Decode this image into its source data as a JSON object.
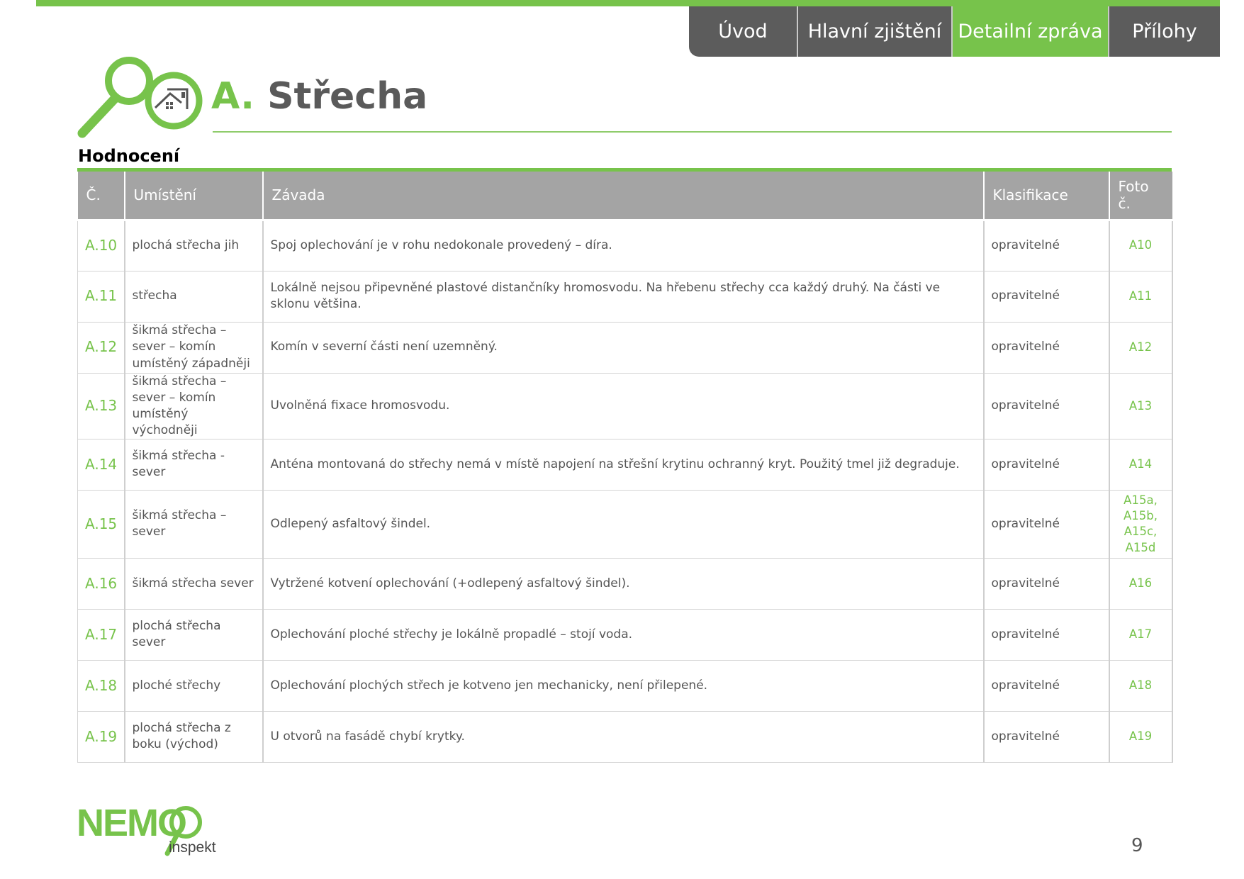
{
  "nav": {
    "tabs": [
      {
        "label": "Úvod",
        "active": false
      },
      {
        "label": "Hlavní zjištění",
        "active": false
      },
      {
        "label": "Detailní zpráva",
        "active": true
      },
      {
        "label": "Přílohy",
        "active": false
      }
    ]
  },
  "header": {
    "section_letter": "A.",
    "section_name": "Střecha",
    "icons": [
      "magnifier-icon",
      "house-roof-icon"
    ]
  },
  "subheading": "Hodnocení",
  "table": {
    "columns": [
      "Č.",
      "Umístění",
      "Závada",
      "Klasifikace",
      "Foto č."
    ],
    "rows": [
      {
        "num": "A.10",
        "location": "plochá střecha jih",
        "defect": "Spoj oplechování je v rohu nedokonale provedený – díra.",
        "class": "opravitelné",
        "photo": "A10"
      },
      {
        "num": "A.11",
        "location": "střecha",
        "defect": "Lokálně nejsou připevněné plastové distančníky hromosvodu. Na hřebenu střechy cca každý druhý. Na části ve sklonu většina.",
        "class": "opravitelné",
        "photo": "A11"
      },
      {
        "num": "A.12",
        "location": "šikmá střecha – sever – komín umístěný západněji",
        "defect": "Komín v severní části není uzemněný.",
        "class": "opravitelné",
        "photo": "A12"
      },
      {
        "num": "A.13",
        "location": "šikmá střecha – sever – komín umístěný východněji",
        "defect": "Uvolněná fixace hromosvodu.",
        "class": "opravitelné",
        "photo": "A13"
      },
      {
        "num": "A.14",
        "location": "šikmá střecha - sever",
        "defect": "Anténa montovaná do střechy nemá v místě napojení na střešní krytinu ochranný kryt. Použitý tmel již degraduje.",
        "class": "opravitelné",
        "photo": "A14"
      },
      {
        "num": "A.15",
        "location": "šikmá střecha – sever",
        "defect": "Odlepený asfaltový šindel.",
        "class": "opravitelné",
        "photo": "A15a, A15b, A15c, A15d"
      },
      {
        "num": "A.16",
        "location": "šikmá střecha sever",
        "defect": "Vytržené kotvení oplechování (+odlepený asfaltový šindel).",
        "class": "opravitelné",
        "photo": "A16"
      },
      {
        "num": "A.17",
        "location": "plochá střecha sever",
        "defect": "Oplechování ploché střechy je lokálně propadlé – stojí voda.",
        "class": "opravitelné",
        "photo": "A17"
      },
      {
        "num": "A.18",
        "location": "ploché střechy",
        "defect": "Oplechování plochých střech je kotveno jen mechanicky, není přilepené.",
        "class": "opravitelné",
        "photo": "A18"
      },
      {
        "num": "A.19",
        "location": "plochá střecha z boku (východ)",
        "defect": "U otvorů na fasádě chybí krytky.",
        "class": "opravitelné",
        "photo": "A19"
      }
    ]
  },
  "footer": {
    "logo_text": "NEMO",
    "logo_subtext": "inspekt",
    "page_number": "9"
  },
  "colors": {
    "accent_green": "#77c34b",
    "nav_gray": "#5c5c5c",
    "header_gray": "#a4a4a4"
  }
}
